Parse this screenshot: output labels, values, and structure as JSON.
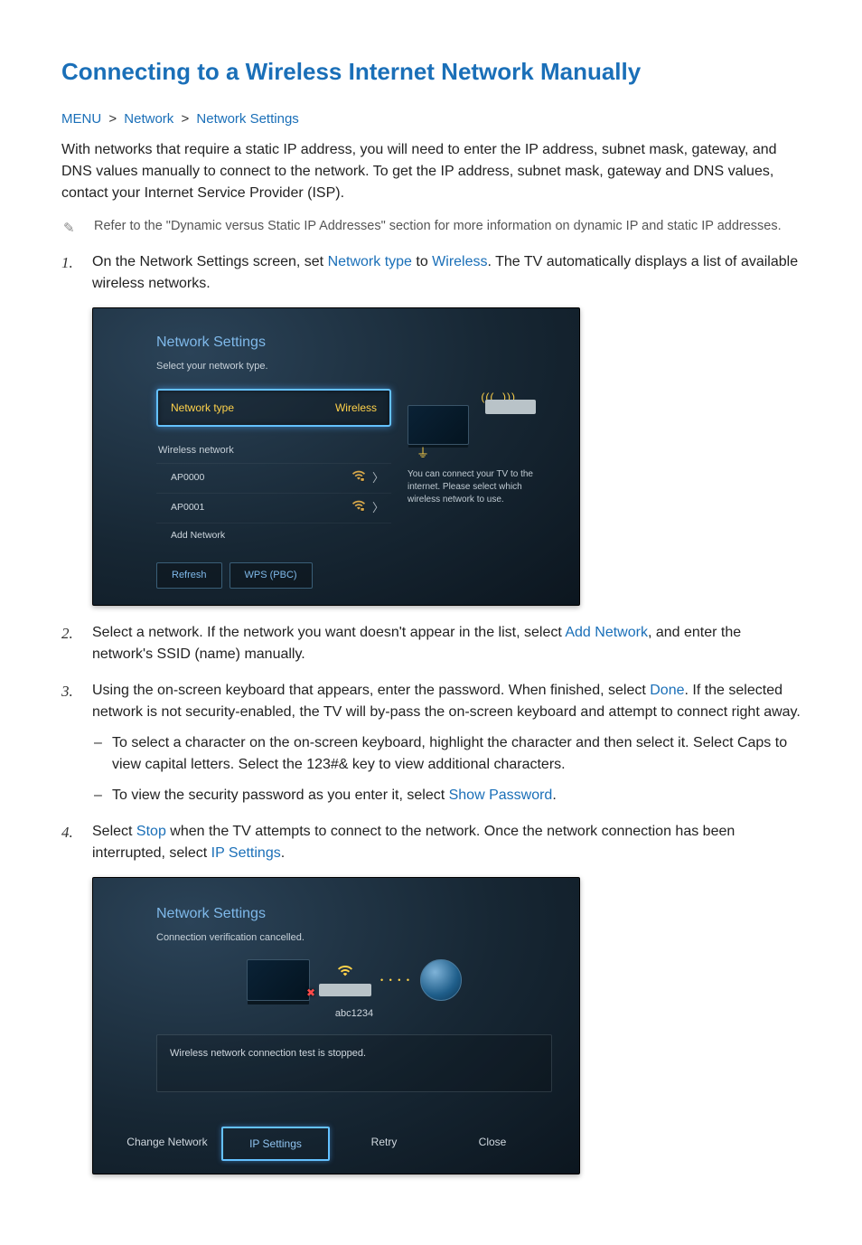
{
  "title": "Connecting to a Wireless Internet Network Manually",
  "breadcrumb": {
    "a": "MENU",
    "b": "Network",
    "c": "Network Settings"
  },
  "intro": "With networks that require a static IP address, you will need to enter the IP address, subnet mask, gateway, and DNS values manually to connect to the network. To get the IP address, subnet mask, gateway and DNS values, contact your Internet Service Provider (ISP).",
  "note": "Refer to the \"Dynamic versus Static IP Addresses\" section for more information on dynamic IP and static IP addresses.",
  "step1": {
    "pre": "On the Network Settings screen, set ",
    "kw1": "Network type",
    "mid": " to ",
    "kw2": "Wireless",
    "post": ". The TV automatically displays a list of available wireless networks."
  },
  "panel1": {
    "title": "Network Settings",
    "subtitle": "Select your network type.",
    "ntLabel": "Network type",
    "ntValue": "Wireless",
    "wnHeader": "Wireless network",
    "items": [
      {
        "ssid": "AP0000"
      },
      {
        "ssid": "AP0001"
      },
      {
        "ssid": "Add Network"
      }
    ],
    "info": "You can connect your TV to the internet. Please select which wireless network to use.",
    "refresh": "Refresh",
    "wps": "WPS (PBC)"
  },
  "step2": {
    "pre": "Select a network. If the network you want doesn't appear in the list, select ",
    "kw": "Add Network",
    "post": ", and enter the network's SSID (name) manually."
  },
  "step3": {
    "pre": "Using the on-screen keyboard that appears, enter the password. When finished, select ",
    "kw": "Done",
    "post": ". If the selected network is not security-enabled, the TV will by-pass the on-screen keyboard and attempt to connect right away.",
    "sub1": "To select a character on the on-screen keyboard, highlight the character and then select it. Select Caps to view capital letters. Select the 123#& key to view additional characters.",
    "sub2pre": "To view the security password as you enter it, select ",
    "sub2kw": "Show Password",
    "sub2post": "."
  },
  "step4": {
    "pre": "Select ",
    "kw1": "Stop",
    "mid": " when the TV attempts to connect to the network. Once the network connection has been interrupted, select ",
    "kw2": "IP Settings",
    "post": "."
  },
  "panel2": {
    "title": "Network Settings",
    "subtitle": "Connection verification cancelled.",
    "apLabel": "abc1234",
    "status": "Wireless network connection test is stopped.",
    "btns": {
      "change": "Change Network",
      "ip": "IP Settings",
      "retry": "Retry",
      "close": "Close"
    }
  }
}
